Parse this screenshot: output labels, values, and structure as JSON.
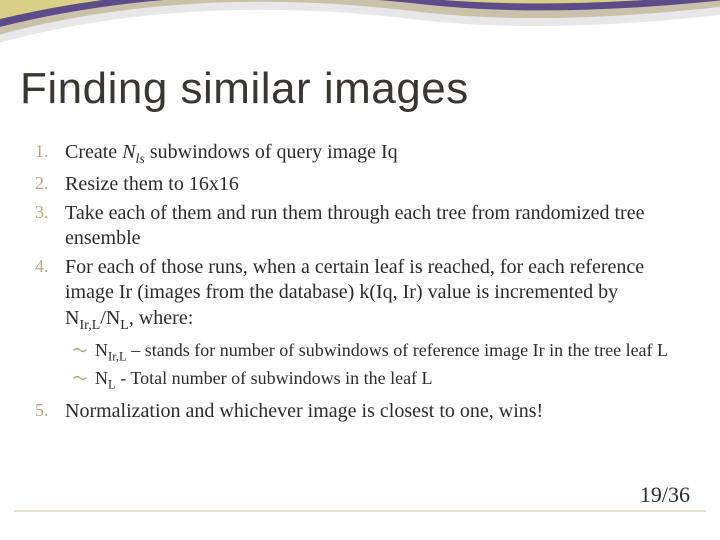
{
  "title": "Finding similar images",
  "items": {
    "0": "Create N_ls subwindows of query image Iq",
    "1": "Resize them to 16x16",
    "2": "Take each of them and run them through each tree from randomized tree ensemble",
    "3": "For each of those runs, when a certain leaf is reached, for each reference image Ir (images from the database) k(Iq, Ir) value is incremented by N_Ir,L / N_L, where:",
    "4": "Normalization and whichever image is closest to one, wins!"
  },
  "subitems": {
    "0": "N_Ir,L – stands for number of subwindows of reference image Ir in the tree leaf L",
    "1": "N_L - Total number of subwindows in the leaf L"
  },
  "pageNumber": "19/36",
  "colors": {
    "titleText": "#3a3632",
    "bullet": "#b9a97d",
    "accentPurple": "#5d4b8a",
    "accentYellow": "#d9d088",
    "accentTan": "#c9c2a9",
    "footerLine": "#e8e2cf"
  }
}
